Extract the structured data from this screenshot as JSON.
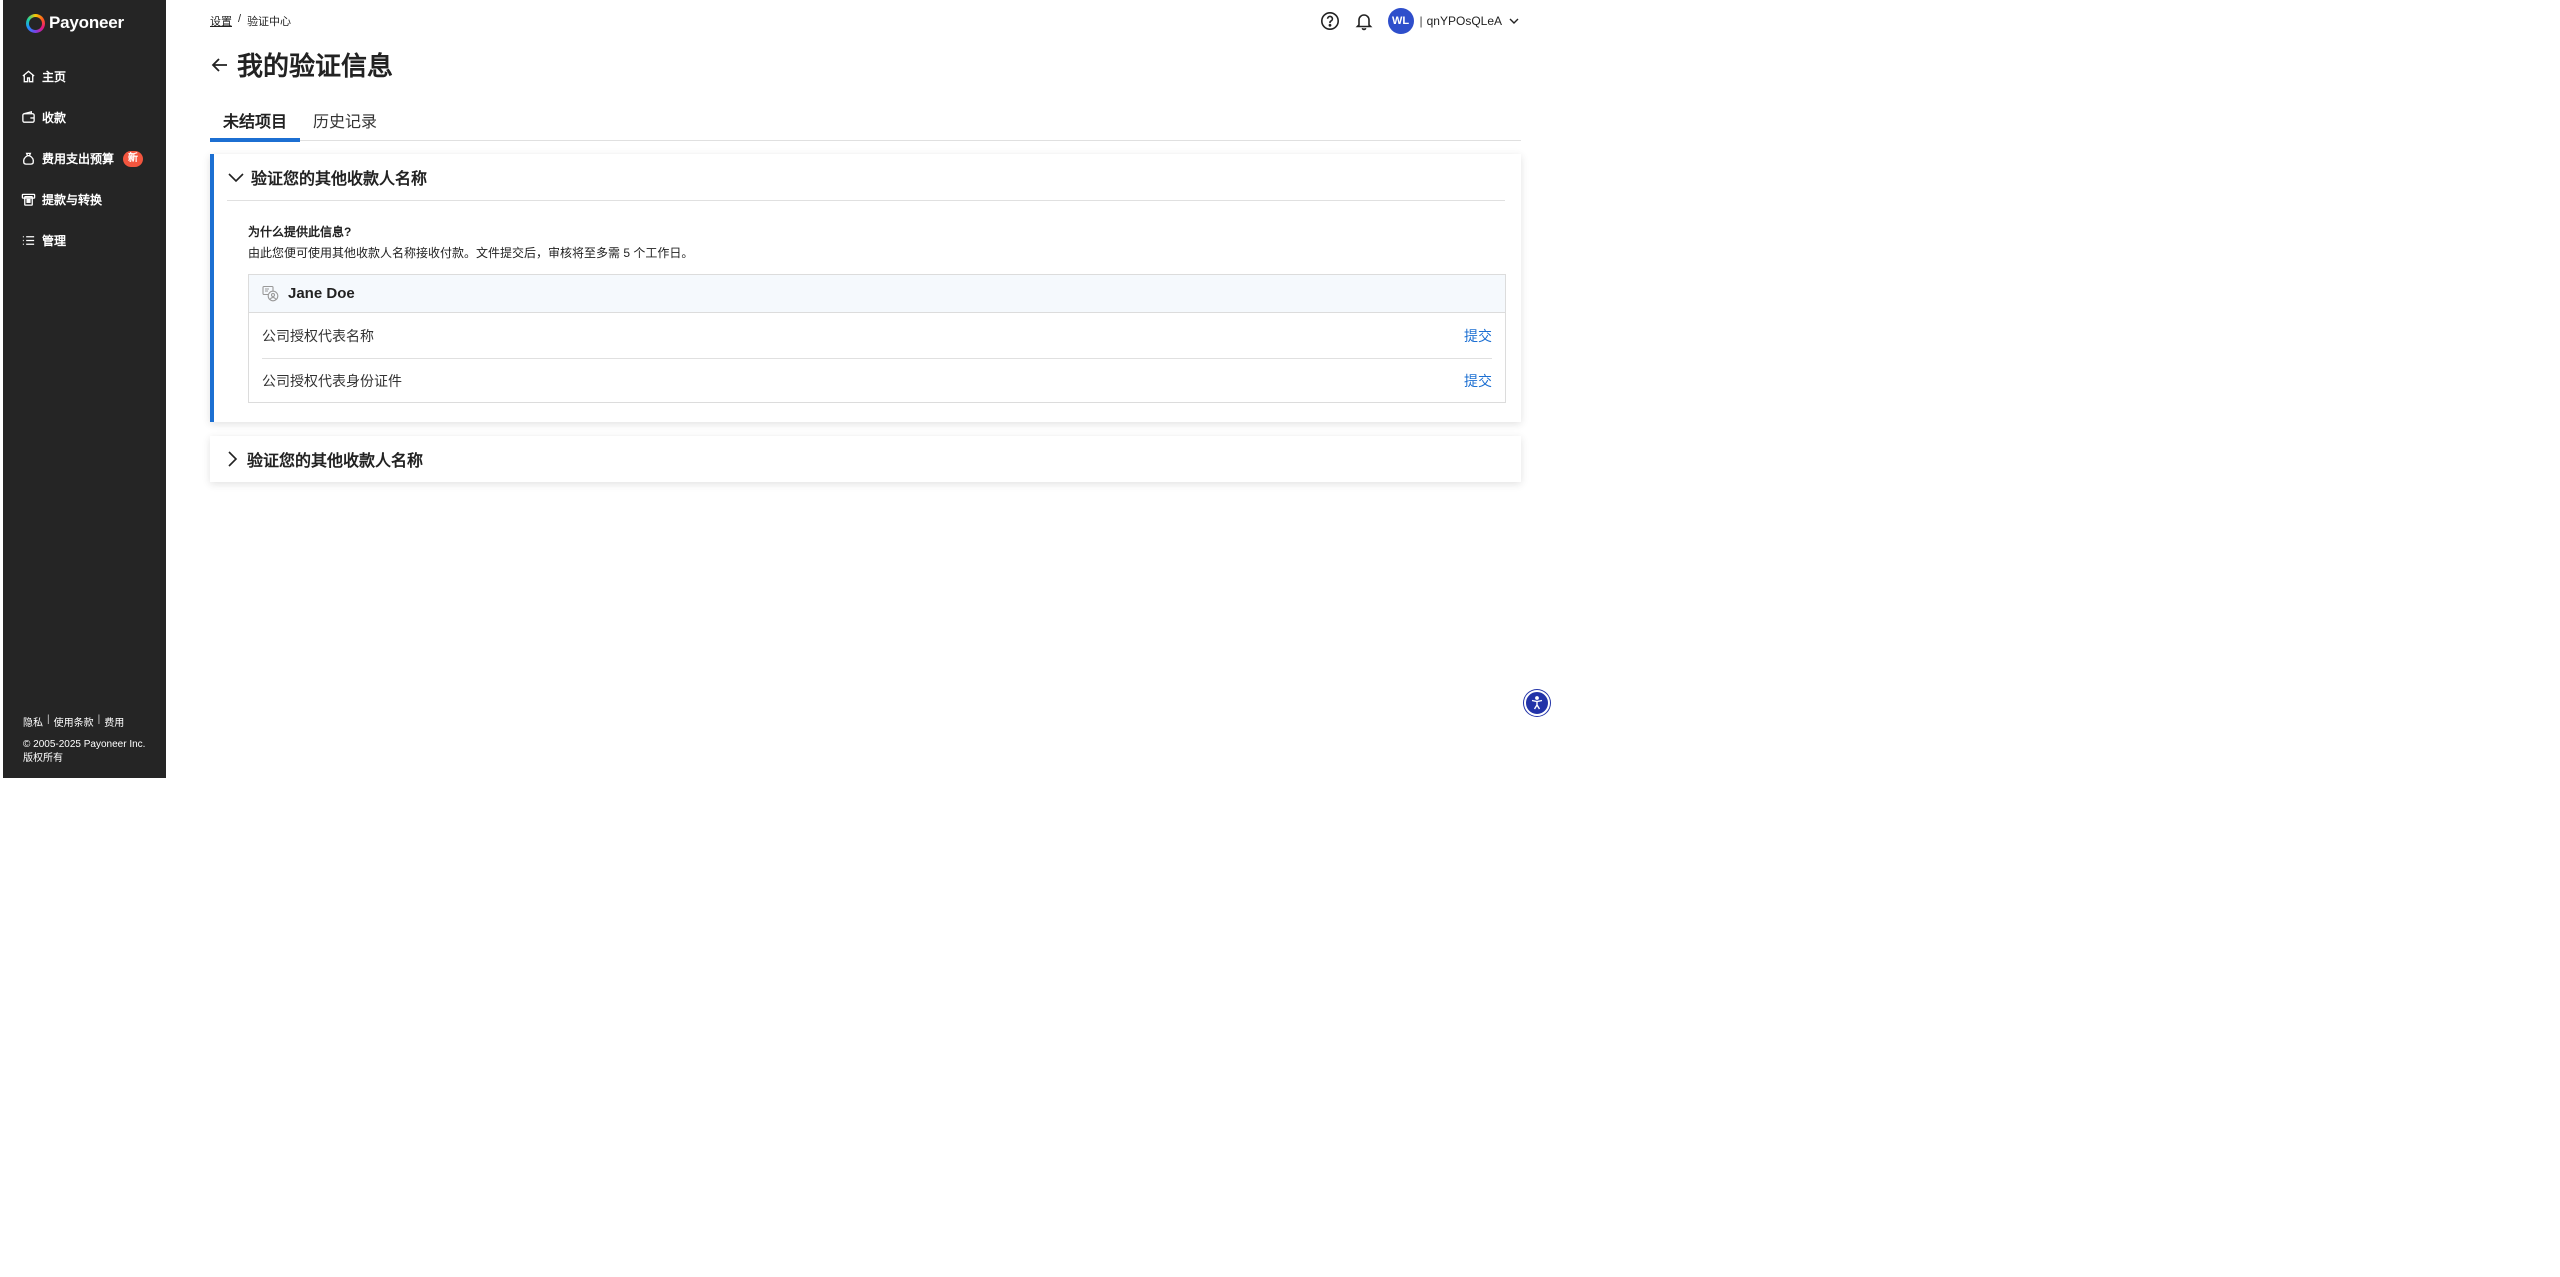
{
  "brand": {
    "name": "Payoneer"
  },
  "sidebar": {
    "items": [
      {
        "label": "主页",
        "icon": "home-icon"
      },
      {
        "label": "收款",
        "icon": "wallet-icon"
      },
      {
        "label": "费用支出预算",
        "icon": "money-bag-icon",
        "badge": "新"
      },
      {
        "label": "提款与转换",
        "icon": "withdraw-icon"
      },
      {
        "label": "管理",
        "icon": "list-icon"
      }
    ],
    "footer_links": [
      "隐私",
      "使用条款",
      "费用"
    ],
    "footer_sep": "|",
    "copyright_line1": "© 2005-2025 Payoneer Inc.",
    "copyright_line2": "版权所有"
  },
  "breadcrumb": {
    "parent": "设置",
    "separator": "/",
    "current": "验证中心"
  },
  "user": {
    "initials": "WL",
    "separator": "|",
    "name": "qnYPOsQLeA"
  },
  "page": {
    "title": "我的验证信息"
  },
  "tabs": [
    {
      "label": "未结项目",
      "active": true
    },
    {
      "label": "历史记录",
      "active": false
    }
  ],
  "cards": [
    {
      "title": "验证您的其他收款人名称",
      "expanded": true,
      "why_title": "为什么提供此信息?",
      "why_desc": "由此您便可使用其他收款人名称接收付款。文件提交后，审核将至多需 5 个工作日。",
      "person_name": "Jane Doe",
      "requirements": [
        {
          "label": "公司授权代表名称",
          "action": "提交"
        },
        {
          "label": "公司授权代表身份证件",
          "action": "提交"
        }
      ]
    },
    {
      "title": "验证您的其他收款人名称",
      "expanded": false
    }
  ],
  "colors": {
    "accent": "#1c6fd2",
    "sidebar_bg": "#252525",
    "badge": "#f2553e",
    "avatar": "#2e4ecb"
  }
}
